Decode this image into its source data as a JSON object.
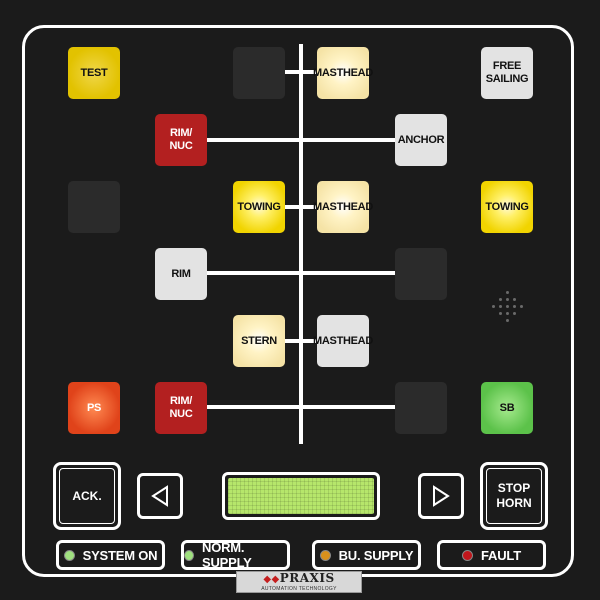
{
  "keys": {
    "test": "TEST",
    "masthead_top": "MASTHEAD",
    "free_sailing_1": "FREE",
    "free_sailing_2": "SAILING",
    "rim_nuc_top_1": "RIM/",
    "rim_nuc_top_2": "NUC",
    "anchor": "ANCHOR",
    "towing_mid": "TOWING",
    "masthead_mid": "MASTHEAD",
    "towing_right": "TOWING",
    "rim": "RIM",
    "stern": "STERN",
    "masthead_low": "MASTHEAD",
    "ps": "PS",
    "rim_nuc_bottom_1": "RIM/",
    "rim_nuc_bottom_2": "NUC",
    "sb": "SB"
  },
  "controls": {
    "ack": "ACK.",
    "stop_horn_1": "STOP",
    "stop_horn_2": "HORN"
  },
  "status": {
    "system_on": "SYSTEM ON",
    "norm_supply": "NORM. SUPPLY",
    "bu_supply": "BU. SUPPLY",
    "fault": "FAULT"
  },
  "leds": {
    "system_on_color": "#9fe07f",
    "norm_supply_color": "#9fe07f",
    "bu_supply_color": "#d9901c",
    "fault_color": "#c0161c"
  },
  "logo": {
    "name": "PRAXIS",
    "tagline": "AUTOMATION TECHNOLOGY"
  },
  "icons": {
    "left": "arrow-left-icon",
    "right": "arrow-right-icon"
  }
}
